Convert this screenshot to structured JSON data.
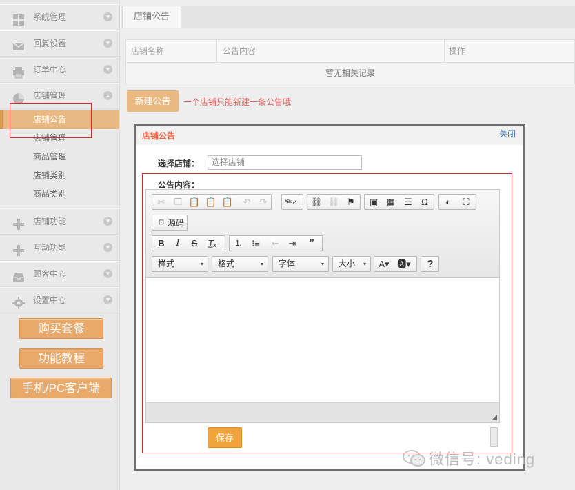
{
  "sidebar": {
    "items": [
      {
        "label": "系统管理",
        "icon": "grid-icon"
      },
      {
        "label": "回复设置",
        "icon": "envelope-icon"
      },
      {
        "label": "订单中心",
        "icon": "printer-icon"
      },
      {
        "label": "店铺管理",
        "icon": "pie-chart-icon",
        "expanded": true
      }
    ],
    "submenu": [
      "店铺公告",
      "店铺管理",
      "商品管理",
      "店铺类别",
      "商品类别"
    ],
    "items_after": [
      {
        "label": "店铺功能",
        "icon": "plus-icon"
      },
      {
        "label": "互动功能",
        "icon": "plus-icon"
      },
      {
        "label": "顾客中心",
        "icon": "inbox-icon"
      },
      {
        "label": "设置中心",
        "icon": "gear-icon"
      }
    ],
    "buttons": [
      "购买套餐",
      "功能教程",
      "手机/PC客户端"
    ]
  },
  "main": {
    "tab": "店铺公告",
    "table": {
      "columns": [
        "店铺名称",
        "公告内容",
        "操作"
      ],
      "empty_text": "暂无相关记录"
    },
    "new_button": "新建公告",
    "hint": "一个店铺只能新建一条公告哦"
  },
  "modal": {
    "title": "店铺公告",
    "close": "关闭",
    "shop_label": "选择店铺：",
    "shop_placeholder": "选择店铺",
    "content_label": "公告内容：",
    "toolbar": {
      "source_label": "源码",
      "combos": [
        "样式",
        "格式",
        "字体",
        "大小"
      ]
    },
    "save_button": "保存"
  },
  "watermark": "微信号: veding",
  "colors": {
    "accent": "#e8b982",
    "title_orange": "#e8603c",
    "link_blue": "#3b79c3",
    "hint_red": "#e05858",
    "save_orange": "#f0a43a"
  }
}
